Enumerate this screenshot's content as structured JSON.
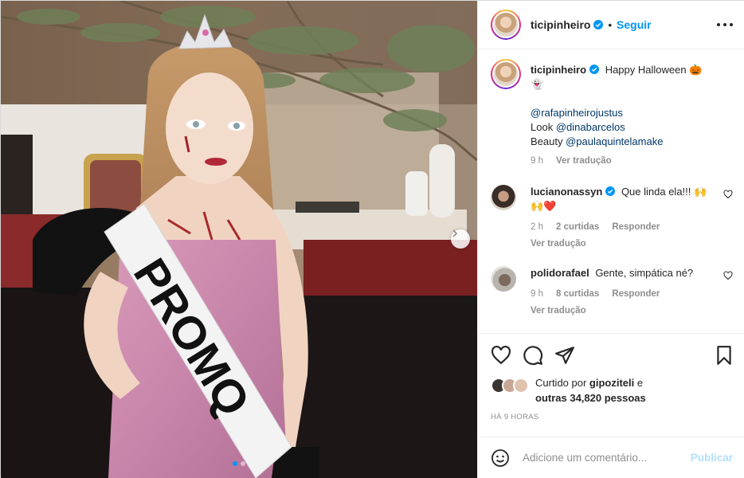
{
  "post": {
    "username": "ticipinheiro",
    "separator": "•",
    "follow_label": "Seguir",
    "carousel": {
      "slide_count": 2,
      "active_slide": 1
    },
    "sash_text": "PROMQ"
  },
  "caption": {
    "username": "ticipinheiro",
    "text": "Happy Halloween",
    "emoji_1": "🎃",
    "emoji_2": "👻",
    "mention_1": "@rafapinheirojustus",
    "look_prefix": "Look ",
    "mention_2": "@dinabarcelos",
    "beauty_prefix": "Beauty ",
    "mention_3": "@paulaquintelamake",
    "time": "9 h",
    "translate": "Ver tradução"
  },
  "comments": [
    {
      "username": "lucianonassyn",
      "text": "Que linda ela!!!",
      "emoji": "🙌",
      "emoji_2": "🙌",
      "emoji_3": "❤️",
      "time": "2 h",
      "likes": "2 curtidas",
      "reply": "Responder",
      "translate": "Ver tradução"
    },
    {
      "username": "polidorafael",
      "text": "Gente, simpática né?",
      "time": "9 h",
      "likes": "8 curtidas",
      "reply": "Responder",
      "translate": "Ver tradução"
    }
  ],
  "likes": {
    "prefix": "Curtido por ",
    "user": "gipoziteli",
    "conj": " e",
    "others": "outras 34,820 pessoas"
  },
  "timestamp": "HÁ 9 HORAS",
  "composer": {
    "placeholder": "Adicione um comentário...",
    "publish_label": "Publicar"
  },
  "colors": {
    "accent": "#0095f6",
    "verified": "#0095f6",
    "publish_disabled": "#b2dffc",
    "like_red": "#ed4956"
  }
}
